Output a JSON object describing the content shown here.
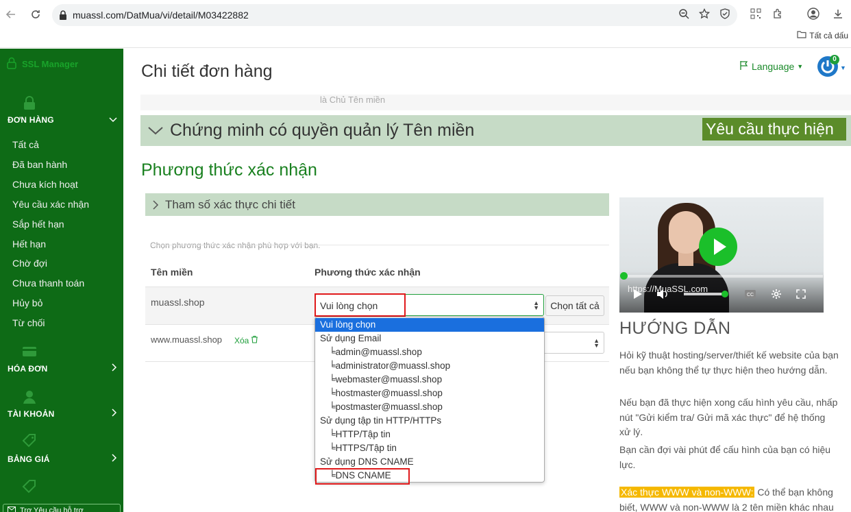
{
  "browser": {
    "url": "muassl.com/DatMua/vi/detail/M03422882",
    "bookmark": "Tất cả dấu"
  },
  "sidebar": {
    "brand": "SSL Manager",
    "sections": [
      {
        "title": "ĐƠN HÀNG",
        "items": [
          "Tất cả",
          "Đã ban hành",
          "Chưa kích hoạt",
          "Yêu cầu xác nhận",
          "Sắp hết hạn",
          "Hết hạn",
          "Chờ đợi",
          "Chưa thanh toán",
          "Hủy bỏ",
          "Từ chối"
        ]
      },
      {
        "title": "HÓA ĐƠN"
      },
      {
        "title": "TÀI KHOẢN"
      },
      {
        "title": "BẢNG GIÁ"
      }
    ],
    "bottom_text": "Trợ Yêu cầu hỗ trợ"
  },
  "header": {
    "title": "Chi tiết đơn hàng",
    "language": "Language",
    "notif_count": "0"
  },
  "main": {
    "strip_text": "là Chủ Tên miền",
    "proof_title": "Chứng minh có quyền quản lý Tên miền",
    "request_badge": "Yêu cầu thực hiện",
    "method_title": "Phương thức xác nhận",
    "params_title": "Tham số xác thực chi tiết",
    "hint": "Chọn phương thức xác nhận phù hợp với bạn.",
    "col_domain": "Tên miền",
    "col_method": "Phương thức xác nhận",
    "rows": [
      {
        "domain": "muassl.shop",
        "value": "Vui lòng chọn"
      },
      {
        "domain": "www.muassl.shop",
        "delete_label": "Xóa"
      }
    ],
    "choose_all": "Chọn tất cả",
    "dropdown_options": [
      {
        "label": "Vui lòng chọn",
        "type": "selected"
      },
      {
        "label": "Sử dụng Email",
        "type": "group"
      },
      {
        "label": "╘admin@muassl.shop",
        "type": "child"
      },
      {
        "label": "╘administrator@muassl.shop",
        "type": "child"
      },
      {
        "label": "╘webmaster@muassl.shop",
        "type": "child"
      },
      {
        "label": "╘hostmaster@muassl.shop",
        "type": "child"
      },
      {
        "label": "╘postmaster@muassl.shop",
        "type": "child"
      },
      {
        "label": "Sử dụng tập tin HTTP/HTTPs",
        "type": "group"
      },
      {
        "label": "╘HTTP/Tập tin",
        "type": "child"
      },
      {
        "label": "╘HTTPS/Tập tin",
        "type": "child"
      },
      {
        "label": "Sử dụng DNS CNAME",
        "type": "group"
      },
      {
        "label": "╘DNS CNAME",
        "type": "child"
      }
    ]
  },
  "guide": {
    "video_watermark": "https://MuaSSL.com",
    "title": "HƯỚNG DẪN",
    "p1": "Hỏi kỹ thuật hosting/server/thiết kế website của bạn nếu bạn không thể tự thực hiện theo hướng dẫn.",
    "p2": "Nếu bạn đã thực hiện xong cấu hình yêu cầu, nhấp nút \"Gửi kiểm tra/ Gửi mã xác thực\" để hệ thống xử lý.",
    "p3": "Bạn cần đợi vài phút để cấu hình của bạn có hiệu lực.",
    "www_tag": "Xác thực WWW và non-WWW:",
    "p4": " Có thể bạn không biết, WWW và non-WWW là 2 tên miền khác nhau"
  },
  "colors": {
    "sidebar": "#0e6b16",
    "accent": "#19801f",
    "highlight": "#e0191b",
    "selected_option": "#1a6fde"
  }
}
